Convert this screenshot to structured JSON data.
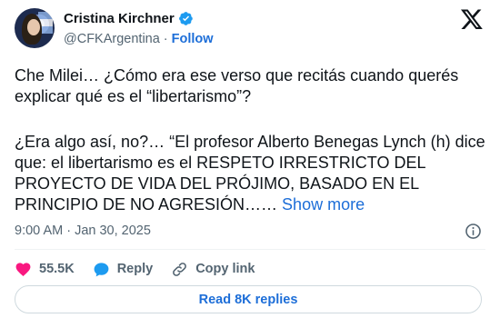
{
  "author": {
    "name": "Cristina Kirchner",
    "handle": "@CFKArgentina",
    "separator": "·",
    "follow_label": "Follow",
    "verified_icon": "verified-badge-icon",
    "avatar_icon": "avatar"
  },
  "platform_icon": "x-logo-icon",
  "tweet": {
    "paragraph1": "Che Milei… ¿Cómo era ese verso que recitás cuando querés explicar qué es el “libertarismo”?",
    "paragraph2": "¿Era algo así, no?… “El profesor Alberto Benegas Lynch (h) dice que: el libertarismo es el RESPETO IRRESTRICTO DEL PROYECTO DE VIDA DEL PRÓJIMO, BASADO EN EL PRINCIPIO DE NO AGRESIÓN…… ",
    "show_more": "Show more"
  },
  "meta": {
    "timestamp": "9:00 AM · Jan 30, 2025",
    "info_icon": "info-icon"
  },
  "actions": {
    "likes": "55.5K",
    "reply_label": "Reply",
    "copy_link_label": "Copy link",
    "like_color": "#f91880",
    "reply_color": "#1d9bf0"
  },
  "replies": {
    "read_label": "Read 8K replies"
  },
  "colors": {
    "accent": "#1d6ed8",
    "muted": "#536471",
    "text": "#0f1419"
  }
}
